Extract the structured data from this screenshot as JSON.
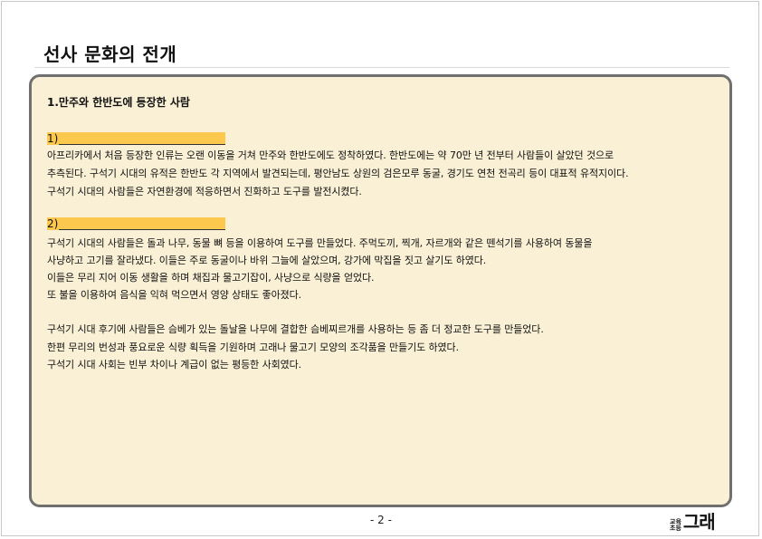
{
  "title": "선사 문화의 전개",
  "section": {
    "heading": "1.만주와 한반도에 등장한 사람",
    "blank1_label": "1)",
    "paragraph1": [
      " 아프리카에서 처음 등장한 인류는 오랜 이동을 거쳐 만주와 한반도에도 정착하였다. 한반도에는 약 70만 년 전부터 사람들이 살았던 것으로",
      "추측된다. 구석기 시대의 유적은 한반도 각 지역에서 발견되는데, 평안남도 상원의 검은모루 동굴, 경기도 연천 전곡리 등이 대표적 유적지이다.",
      "구석기 시대의 사람들은 자연환경에 적응하면서 진화하고 도구를 발전시켰다."
    ],
    "blank2_label": "2)",
    "paragraph2": [
      " 구석기 시대의 사람들은 돌과 나무, 동물 뼈 등을 이용하여 도구를 만들었다. 주먹도끼, 찍개, 자르개와 같은 뗀석기를 사용하여 동물을",
      "사냥하고 고기를 잘라냈다. 이들은 주로 동굴이나 바위 그늘에 살았으며, 강가에 막집을 짓고 살기도 하였다.",
      " 이들은 무리 지어 이동 생활을 하며 채집과 물고기잡이, 사냥으로 식량을 얻었다.",
      "또 불을 이용하여 음식을 익혀 먹으면서 영양 상태도 좋아졌다."
    ],
    "paragraph3": [
      "구석기 시대 후기에 사람들은 슴베가 있는 돌날을 나무에 결합한 슴베찌르개를 사용하는 등 좀 더 정교한 도구를 만들었다.",
      "한편 무리의 번성과 풍요로운 식량 획득을 기원하며 고래나 물고기 모양의 조각품을 만들기도 하였다.",
      "구석기 시대 사회는 빈부 차이나 계급이 없는 평등한 사회였다."
    ]
  },
  "footer": {
    "page_number": "- 2 -",
    "logo_small_top": "교육",
    "logo_small_bottom": "초등",
    "logo_big": "그래"
  },
  "colors": {
    "panel_bg": "#f9f0d5",
    "panel_border": "#707070",
    "blank_highlight": "#fcc84d"
  }
}
